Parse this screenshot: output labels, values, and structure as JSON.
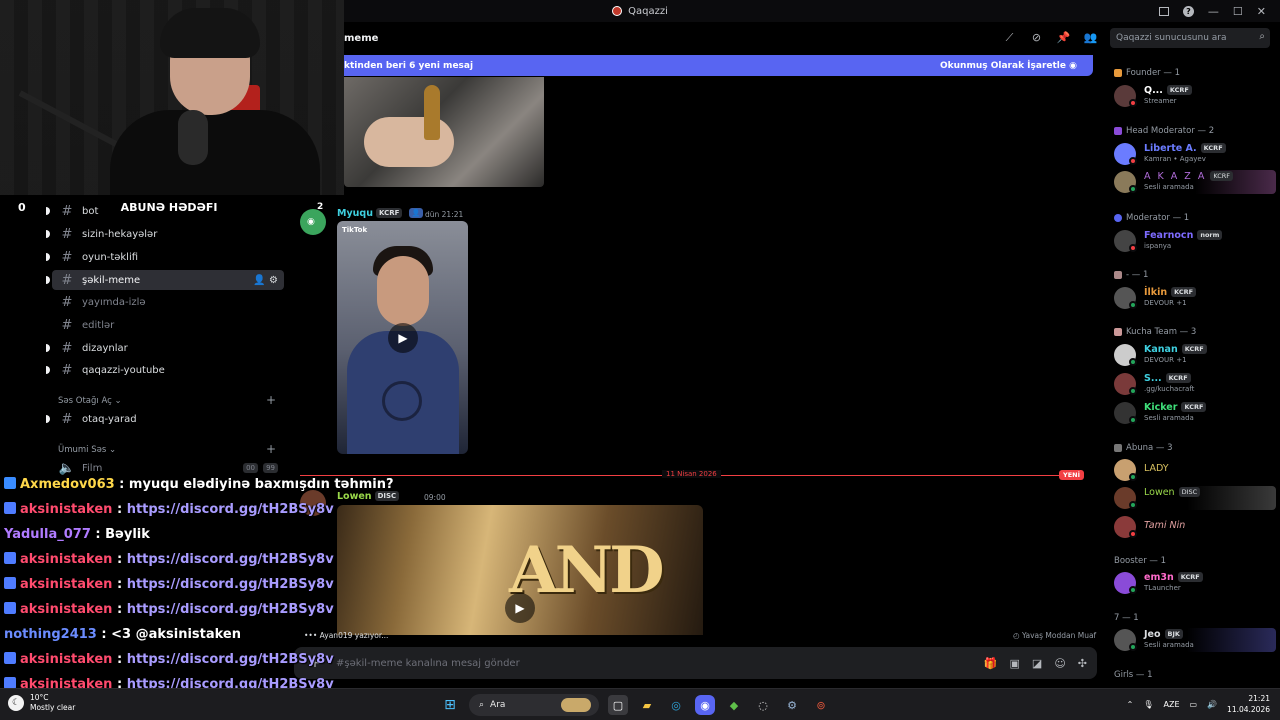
{
  "window": {
    "title": "Qaqazzi"
  },
  "header": {
    "channel_name": "meme",
    "search_placeholder": "Qaqazzi sunucusunu ara"
  },
  "new_messages_bar": {
    "left_text": "ktinden beri 6 yeni mesaj",
    "right_text": "Okunmuş Olarak İşaretle"
  },
  "overlay": {
    "goal_count": "0",
    "goal_title": "ABUNƏ HƏDƏFI"
  },
  "sidebar": {
    "channels": [
      {
        "label": "bot",
        "unread": true
      },
      {
        "label": "sizin-hekayələr",
        "unread": true
      },
      {
        "label": "oyun-təklifi",
        "unread": true
      },
      {
        "label": "şəkil-meme",
        "unread": true,
        "active": true
      },
      {
        "label": "yayımda-izlə",
        "unread": false
      },
      {
        "label": "editlər",
        "unread": false
      },
      {
        "label": "dizaynlar",
        "unread": true
      },
      {
        "label": "qaqazzi-youtube",
        "unread": true
      }
    ],
    "category_voice_create": "Səs Otağı Aç",
    "voice_create_channel": "otaq-yarad",
    "category_general_voice": "Ümumi Səs",
    "voice_film": "Film",
    "voice_film_counts": [
      "00",
      "99"
    ]
  },
  "messages": {
    "msg2": {
      "avatar_badge": "2",
      "author": "Myuqu",
      "role_tag": "KCRF",
      "timestamp": "dün 21:21",
      "video_label": "TikTok"
    },
    "date_divider": "11 Nisan 2026",
    "new_badge": "YENİ",
    "msg3": {
      "author": "Lowen",
      "role_tag": "DISC",
      "timestamp": "09:00",
      "video_text": "AND"
    },
    "typing": "Ayan019 yazıyor...",
    "slowmode": "Yavaş Moddan Muaf",
    "composer_placeholder": "#şəkil-meme kanalına mesaj gönder"
  },
  "members": {
    "groups": [
      {
        "label": "Founder — 1"
      },
      {
        "label": "Head Moderator — 2"
      },
      {
        "label": "Moderator — 1"
      },
      {
        "label": "- — 1"
      },
      {
        "label": "Kucha Team — 3"
      },
      {
        "label": "Abuna — 3"
      },
      {
        "label": "Booster — 1"
      },
      {
        "label": "7 — 1"
      },
      {
        "label": "Girls — 1"
      }
    ],
    "list": [
      {
        "name": "Q...",
        "tag": "KCRF",
        "sub": "Streamer",
        "color": "#ffffff"
      },
      {
        "name": "Liberte A.",
        "tag": "KCRF",
        "sub": "Kamran • Agayev",
        "color": "#6b7cff"
      },
      {
        "name": "A K A Z A",
        "tag": "KCRF",
        "sub": "Sesli aramada",
        "color": "#b06bd8"
      },
      {
        "name": "Fearnocn",
        "tag": "norm",
        "sub": "ispanya",
        "color": "#7d6bff"
      },
      {
        "name": "İlkin",
        "tag": "KCRF",
        "sub": "DEVOUR +1",
        "color": "#e89a3c"
      },
      {
        "name": "Kanan",
        "tag": "KCRF",
        "sub": "DEVOUR +1",
        "color": "#3fd0e0"
      },
      {
        "name": "S...",
        "tag": "KCRF",
        "sub": ".gg/kuchacraft",
        "color": "#3fd0e0"
      },
      {
        "name": "Kicker",
        "tag": "KCRF",
        "sub": "Sesli aramada",
        "color": "#3fe07a"
      },
      {
        "name": "LADY",
        "tag": "",
        "sub": "",
        "color": "#d8c060"
      },
      {
        "name": "Lowen",
        "tag": "DISC",
        "sub": "",
        "color": "#9ad84a"
      },
      {
        "name": "Tami Nin",
        "tag": "",
        "sub": "",
        "color": "#e0a0a0"
      },
      {
        "name": "em3n",
        "tag": "KCRF",
        "sub": "TLauncher",
        "color": "#ff6bcb"
      },
      {
        "name": "Jeo",
        "tag": "BJK",
        "sub": "Sesli aramada",
        "color": "#dbdee1"
      }
    ]
  },
  "chat": [
    {
      "user": "Axmedov063",
      "sep": " : ",
      "text": "myuqu elədiyinə baxmışdın təhmin?",
      "user_color": "#ffd84a",
      "link": false
    },
    {
      "user": "aksinistaken",
      "sep": " : ",
      "text": "https://discord.gg/tH2BSy8v",
      "user_color": "#ff4b6e",
      "link": true
    },
    {
      "user": "Yadulla_077",
      "sep": " : ",
      "text": "Bəylik",
      "user_color": "#b07bff",
      "link": false
    },
    {
      "user": "aksinistaken",
      "sep": " : ",
      "text": "https://discord.gg/tH2BSy8v",
      "user_color": "#ff4b6e",
      "link": true
    },
    {
      "user": "aksinistaken",
      "sep": " : ",
      "text": "https://discord.gg/tH2BSy8v",
      "user_color": "#ff4b6e",
      "link": true
    },
    {
      "user": "aksinistaken",
      "sep": " : ",
      "text": "https://discord.gg/tH2BSy8v",
      "user_color": "#ff4b6e",
      "link": true
    },
    {
      "user": "nothing2413",
      "sep": " : ",
      "text": "<3 @aksinistaken",
      "user_color": "#6b8cff",
      "link": false
    },
    {
      "user": "aksinistaken",
      "sep": " : ",
      "text": "https://discord.gg/tH2BSy8v",
      "user_color": "#ff4b6e",
      "link": true
    },
    {
      "user": "aksinistaken",
      "sep": " : ",
      "text": "https://discord.gg/tH2BSy8v",
      "user_color": "#ff4b6e",
      "link": true
    }
  ],
  "taskbar": {
    "weather_temp": "10°C",
    "weather_desc": "Mostly clear",
    "search_label": "Ara",
    "lang": "AZE",
    "time": "21:21",
    "date": "11.04.2026"
  }
}
